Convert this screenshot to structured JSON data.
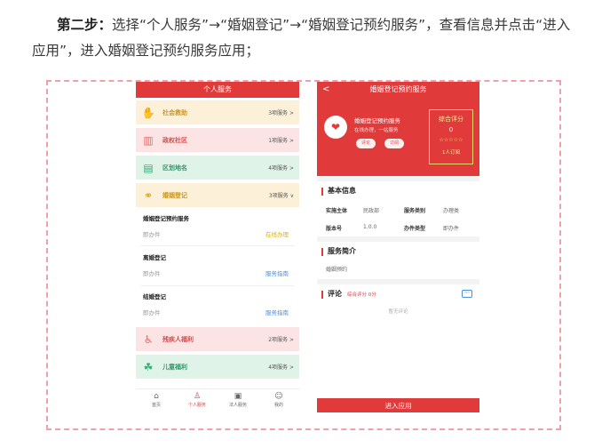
{
  "instruction": {
    "step": "第二步：",
    "text": "选择“个人服务”→“婚姻登记”→“婚姻登记预约服务”，查看信息并点击“进入应用”，进入婚姻登记预约服务应用；"
  },
  "left_phone": {
    "title": "个人服务",
    "categories": [
      {
        "icon": "hands-icon",
        "name": "社会救助",
        "count": "3项服务 >"
      },
      {
        "icon": "building-icon",
        "name": "政权社区",
        "count": "1项服务 >"
      },
      {
        "icon": "map-icon",
        "name": "区划地名",
        "count": "4项服务 >"
      },
      {
        "icon": "rings-icon",
        "name": "婚姻登记",
        "count": "3项服务 ∨"
      }
    ],
    "marriage_services": [
      {
        "title": "婚姻登记预约服务",
        "key": "即办件",
        "action": "在线办理",
        "action_color": "#d7b21e"
      },
      {
        "title": "离婚登记",
        "key": "即办件",
        "action": "服务指南",
        "action_color": "#4a90d9"
      },
      {
        "title": "结婚登记",
        "key": "即办件",
        "action": "服务指南",
        "action_color": "#4a90d9"
      }
    ],
    "more_categories": [
      {
        "icon": "wheelchair-icon",
        "name": "残疾人福利",
        "count": "2项服务 >"
      },
      {
        "icon": "child-icon",
        "name": "儿童福利",
        "count": "4项服务 >"
      }
    ],
    "tabs": [
      {
        "icon": "home-icon",
        "glyph": "⌂",
        "label": "首页"
      },
      {
        "icon": "person-icon",
        "glyph": "♙",
        "label": "个人服务"
      },
      {
        "icon": "briefcase-icon",
        "glyph": "▣",
        "label": "法人服务"
      },
      {
        "icon": "user-icon",
        "glyph": "☺",
        "label": "我的"
      }
    ]
  },
  "right_phone": {
    "title": "婚姻登记预约服务",
    "back": "<",
    "service_name": "婚姻登记预约服务",
    "service_desc": "在线办理，一站服务",
    "pill_review": "评论",
    "pill_subscribe": "订阅",
    "score_label": "综合评分",
    "score_value": "0",
    "stars": "☆☆☆☆☆",
    "subscribers": "1人订阅",
    "basic_info_title": "基本信息",
    "basic_info": [
      {
        "k1": "实施主体",
        "v1": "民政部",
        "k2": "服务类别",
        "v2": "办理类"
      },
      {
        "k1": "版本号",
        "v1": "1.0.0",
        "k2": "办件类型",
        "v2": "即办件"
      }
    ],
    "intro_title": "服务简介",
    "intro_text": "婚姻预约",
    "comment_title": "评论",
    "comment_score": "综合评分 0分",
    "no_comment": "暂无评论",
    "enter_button": "进入应用"
  }
}
